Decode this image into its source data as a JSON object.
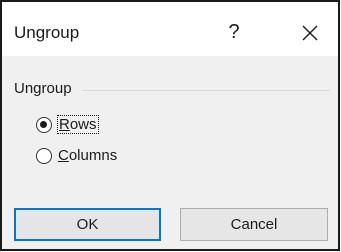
{
  "dialog": {
    "title": "Ungroup",
    "help_glyph": "?",
    "close_icon": "close-icon"
  },
  "group": {
    "label": "Ungroup",
    "options": [
      {
        "label": "Rows",
        "mnemonic": "R",
        "rest": "ows",
        "selected": true
      },
      {
        "label": "Columns",
        "mnemonic": "C",
        "rest": "olumns",
        "selected": false
      }
    ]
  },
  "buttons": {
    "ok_label": "OK",
    "cancel_label": "Cancel"
  },
  "colors": {
    "default_button_border": "#0078d7",
    "dialog_background": "#f0f0f0",
    "frame_border": "#1a1a1a"
  }
}
